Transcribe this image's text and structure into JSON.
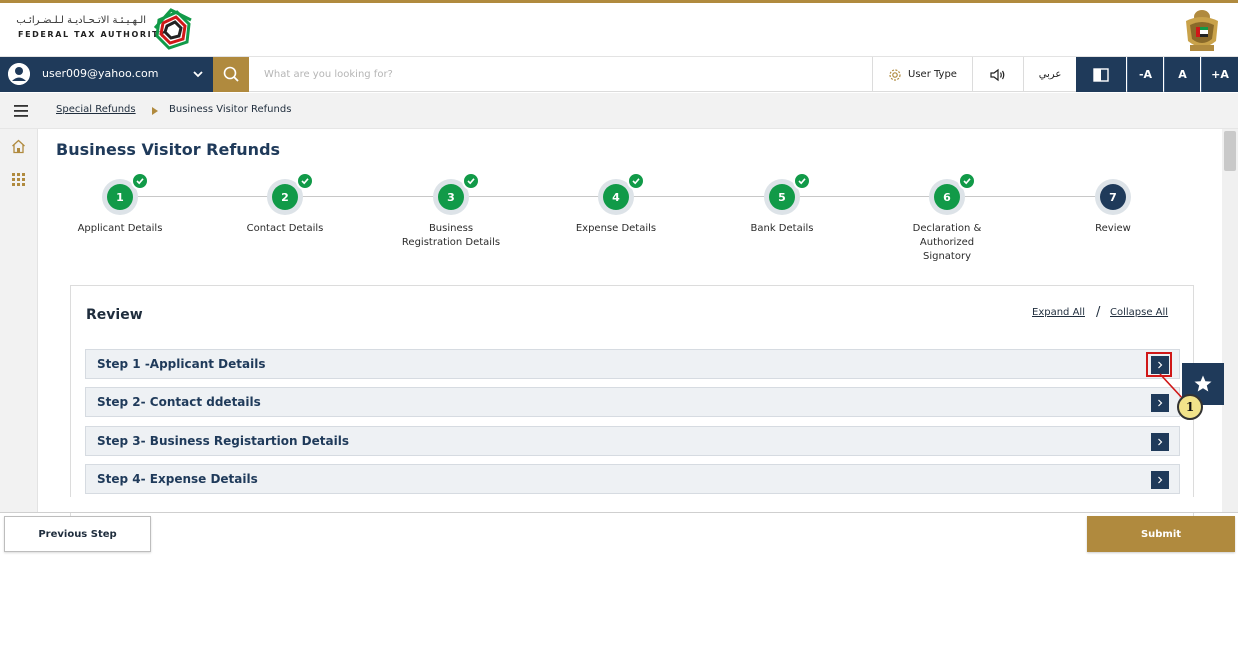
{
  "colors": {
    "gold": "#b08a3e",
    "navy": "#1f3a5a",
    "green": "#119a48",
    "highlight_red": "#d01818",
    "callout_yellow": "#f2e38a"
  },
  "header": {
    "logo_arabic": "الـهـيـئـة الاتـحـاديـة لـلـضـرائـب",
    "logo_english": "FEDERAL TAX AUTHORITY",
    "logo_icon": "fta-logo-icon",
    "emblem_icon": "uae-emblem-icon"
  },
  "toolbar": {
    "user_email": "user009@yahoo.com",
    "search_placeholder": "What are you looking for?",
    "user_type_label": "User Type",
    "language_label": "عربي",
    "font_decrease": "-A",
    "font_normal": "A",
    "font_increase": "+A"
  },
  "breadcrumb": {
    "parent": "Special Refunds",
    "current": "Business Visitor Refunds"
  },
  "main": {
    "title": "Business Visitor Refunds"
  },
  "stepper": {
    "steps": [
      {
        "number": "1",
        "label": "Applicant Details",
        "completed": true
      },
      {
        "number": "2",
        "label": "Contact Details",
        "completed": true
      },
      {
        "number": "3",
        "label": "Business\nRegistration Details",
        "completed": true
      },
      {
        "number": "4",
        "label": "Expense Details",
        "completed": true
      },
      {
        "number": "5",
        "label": "Bank Details",
        "completed": true
      },
      {
        "number": "6",
        "label": "Declaration &\nAuthorized\nSignatory",
        "completed": true
      },
      {
        "number": "7",
        "label": "Review",
        "completed": false
      }
    ]
  },
  "review": {
    "title": "Review",
    "expand_all": "Expand All",
    "separator": "/",
    "collapse_all": "Collapse All",
    "sections": [
      {
        "label": "Step 1 -Applicant Details"
      },
      {
        "label": "Step 2- Contact ddetails"
      },
      {
        "label": "Step 3- Business Registartion Details"
      },
      {
        "label": "Step 4- Expense Details"
      }
    ]
  },
  "annotation": {
    "callout_number": "1"
  },
  "footer": {
    "previous_label": "Previous Step",
    "submit_label": "Submit"
  }
}
